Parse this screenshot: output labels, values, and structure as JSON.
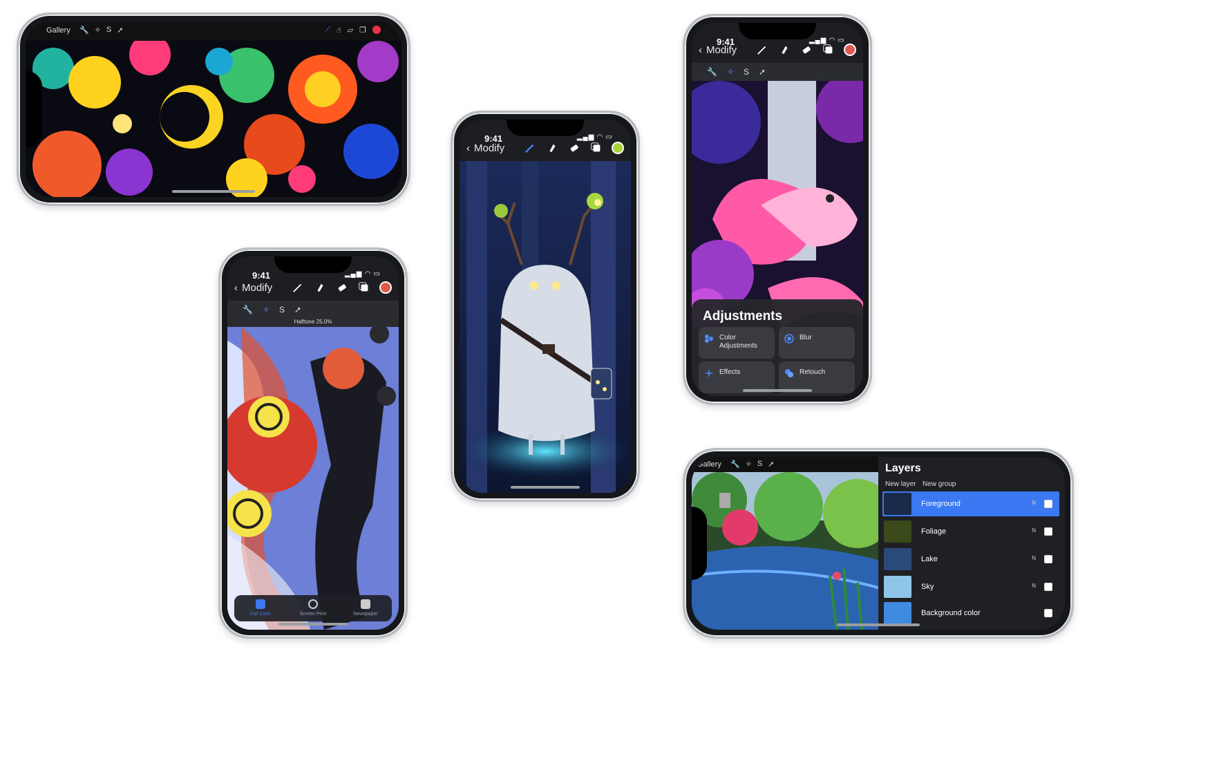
{
  "phone_a": {
    "gallery": "Gallery"
  },
  "phone_b": {
    "time": "9:41",
    "back": "Modify",
    "halftone": "Halftone 25.0%",
    "dock": [
      "Full Color",
      "Screen Print",
      "Newspaper"
    ]
  },
  "phone_c": {
    "time": "9:41",
    "back": "Modify"
  },
  "phone_d": {
    "time": "9:41",
    "back": "Modify",
    "adjustments": {
      "title": "Adjustments",
      "items": [
        "Color Adjustments",
        "Blur",
        "Effects",
        "Retouch"
      ]
    }
  },
  "phone_e": {
    "gallery": "Gallery",
    "layers": {
      "title": "Layers",
      "new_layer": "New layer",
      "new_group": "New group",
      "rows": [
        {
          "name": "Foreground",
          "mode": "N",
          "color": "#3b79f2"
        },
        {
          "name": "Foliage",
          "mode": "N"
        },
        {
          "name": "Lake",
          "mode": "N"
        },
        {
          "name": "Sky",
          "mode": "N"
        },
        {
          "name": "Background color",
          "mode": ""
        }
      ]
    }
  },
  "colors": {
    "accent": "#3b79f2",
    "toolbar": "#1d1e22",
    "panel": "#26262c"
  }
}
